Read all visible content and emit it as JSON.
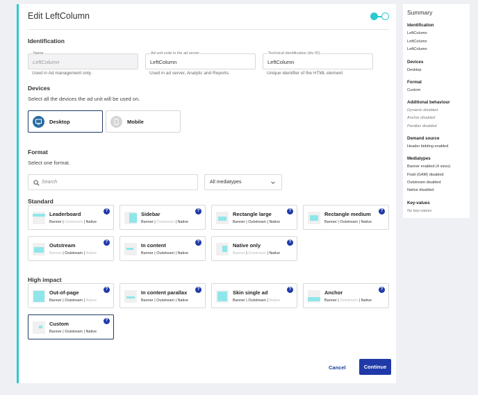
{
  "header": {
    "title": "Edit LeftColumn"
  },
  "identification": {
    "heading": "Identification",
    "name": {
      "label": "Name",
      "placeholder": "LeftColumn",
      "help": "Used in Ad management only."
    },
    "ad_unit_code": {
      "label": "Ad unit code in the ad server",
      "value": "LeftColumn",
      "help": "Used in ad server, Analytic and Reports."
    },
    "technical_id": {
      "label": "Technical identification (div ID)",
      "value": "LeftColumn",
      "help": "Unique identifier of the HTML element"
    }
  },
  "devices": {
    "heading": "Devices",
    "subtitle": "Select all the devices the ad unit will be used on.",
    "items": [
      {
        "label": "Desktop",
        "selected": true,
        "icon": "desktop-icon"
      },
      {
        "label": "Mobile",
        "selected": false,
        "icon": "mobile-icon"
      }
    ]
  },
  "format": {
    "heading": "Format",
    "subtitle": "Select one format.",
    "search_placeholder": "Search",
    "mediatype_select": "All mediatypes",
    "standard_heading": "Standard",
    "high_impact_heading": "High impact",
    "standard": [
      {
        "name": "Leaderboard",
        "banner": true,
        "outstream": false,
        "native": true
      },
      {
        "name": "Sidebar",
        "banner": true,
        "outstream": false,
        "native": true
      },
      {
        "name": "Rectangle large",
        "banner": true,
        "outstream": true,
        "native": true
      },
      {
        "name": "Rectangle medium",
        "banner": true,
        "outstream": true,
        "native": true
      },
      {
        "name": "Outstream",
        "banner": false,
        "outstream": true,
        "native": false
      },
      {
        "name": "In content",
        "banner": true,
        "outstream": true,
        "native": true
      },
      {
        "name": "Native only",
        "banner": false,
        "outstream": false,
        "native": true
      }
    ],
    "high_impact": [
      {
        "name": "Out-of-page",
        "banner": true,
        "outstream": true,
        "native": false
      },
      {
        "name": "In content parallax",
        "banner": true,
        "outstream": true,
        "native": true
      },
      {
        "name": "Skin single ad",
        "banner": true,
        "outstream": true,
        "native": false
      },
      {
        "name": "Anchor",
        "banner": true,
        "outstream": false,
        "native": true
      },
      {
        "name": "Custom",
        "banner": true,
        "outstream": true,
        "native": true,
        "selected": true
      }
    ],
    "type_labels": {
      "banner": "Banner",
      "outstream": "Outstream",
      "native": "Native"
    },
    "help_glyph": "?"
  },
  "actions": {
    "cancel": "Cancel",
    "continue": "Continue"
  },
  "summary": {
    "title": "Summary",
    "identification": {
      "heading": "Identification",
      "values": [
        "LeftColumn",
        "LeftColumn",
        "LeftColumn"
      ]
    },
    "devices": {
      "heading": "Devices",
      "value": "Desktop"
    },
    "format": {
      "heading": "Format",
      "value": "Custom"
    },
    "additional": {
      "heading": "Additional behaviour",
      "values": [
        "Dynamic disabled",
        "Anchor disabled",
        "Parallax disabled"
      ]
    },
    "demand": {
      "heading": "Demand source",
      "value": "Header bidding enabled"
    },
    "mediatypes": {
      "heading": "Mediatypes",
      "values": [
        "Banner enabled (4 sizes)",
        "Fluid (GAM) disabled",
        "Outstream disabled",
        "Native disabled"
      ]
    },
    "keyvalues": {
      "heading": "Key-values",
      "value": "No key-values"
    }
  },
  "colors": {
    "accent": "#2cc9cf",
    "primary": "#1f3aa8",
    "selected_border": "#1f3864"
  }
}
